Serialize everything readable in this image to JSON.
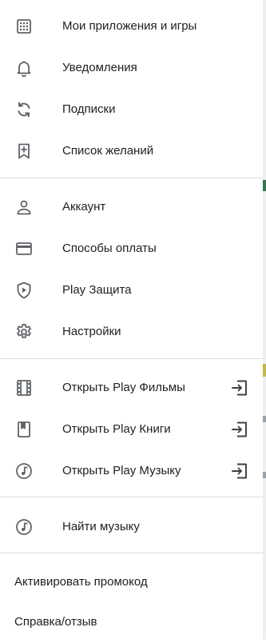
{
  "colors": {
    "text": "#202124",
    "icon": "#5f6368",
    "divider": "#dadce0"
  },
  "menu": {
    "section1": [
      {
        "label": "Мои приложения и игры",
        "icon": "apps-grid-icon"
      },
      {
        "label": "Уведомления",
        "icon": "bell-icon"
      },
      {
        "label": "Подписки",
        "icon": "refresh-icon"
      },
      {
        "label": "Список желаний",
        "icon": "bookmark-add-icon"
      }
    ],
    "section2": [
      {
        "label": "Аккаунт",
        "icon": "person-icon"
      },
      {
        "label": "Способы оплаты",
        "icon": "credit-card-icon"
      },
      {
        "label": "Play Защита",
        "icon": "shield-play-icon"
      },
      {
        "label": "Настройки",
        "icon": "gear-icon"
      }
    ],
    "section3": [
      {
        "label": "Открыть Play Фильмы",
        "icon": "film-icon",
        "ext_icon": "open-app-icon"
      },
      {
        "label": "Открыть Play Книги",
        "icon": "book-icon",
        "ext_icon": "open-app-icon"
      },
      {
        "label": "Открыть Play Музыку",
        "icon": "music-icon",
        "ext_icon": "open-app-icon"
      }
    ],
    "section4": [
      {
        "label": "Найти музыку",
        "icon": "music-icon"
      }
    ],
    "section5": [
      {
        "label": "Активировать промокод"
      },
      {
        "label": "Справка/отзыв"
      }
    ]
  }
}
